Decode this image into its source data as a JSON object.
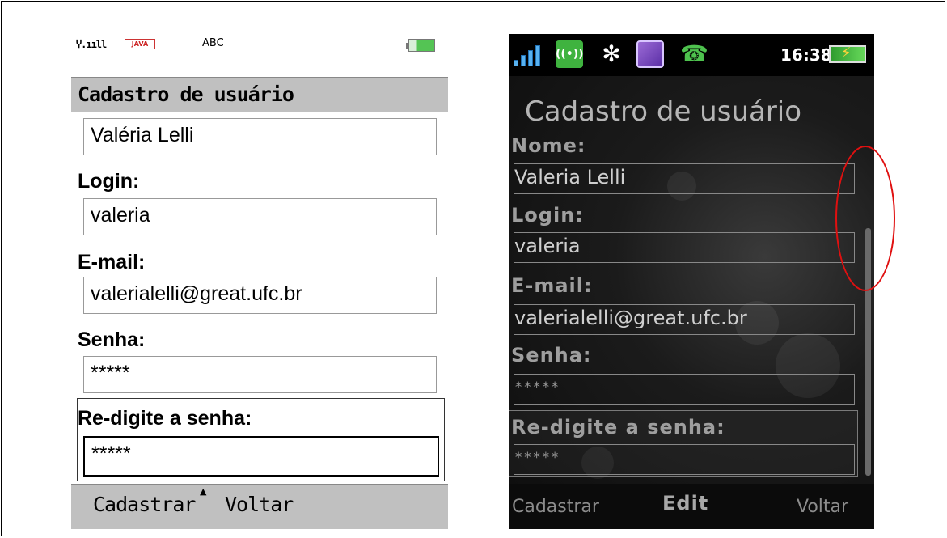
{
  "left_phone": {
    "status": {
      "signal": "Ⴤ.ııll",
      "java_badge": "JAVA",
      "input_mode": "ABC"
    },
    "title": "Cadastro de usuário",
    "fields": {
      "name_value": "Valéria Lelli",
      "login_label": "Login:",
      "login_value": "valeria",
      "email_label": "E-mail:",
      "email_value": "valerialelli@great.ufc.br",
      "password_label": "Senha:",
      "password_value": "*****",
      "repassword_label": "Re-digite a senha:",
      "repassword_value": "*****"
    },
    "softkeys": {
      "left": "Cadastrar",
      "right": "Voltar"
    }
  },
  "right_phone": {
    "status": {
      "time": "16:38",
      "gsm_icon": "gsm-icon",
      "bluetooth_icon": "bluetooth-icon"
    },
    "title": "Cadastro de usuário",
    "fields": {
      "name_label": "Nome:",
      "name_value": "Valeria  Lelli",
      "login_label": "Login:",
      "login_value": "valeria",
      "email_label": "E-mail:",
      "email_value": "valerialelli@great.ufc.br",
      "password_label": "Senha:",
      "password_value": "*****",
      "repassword_label": "Re-digite a senha:",
      "repassword_value": "*****"
    },
    "softkeys": {
      "left": "Cadastrar",
      "middle": "Edit",
      "right": "Voltar"
    }
  },
  "colors": {
    "annotation": "#e01010",
    "left_bar": "#c0c0c0",
    "right_bg": "#111111"
  }
}
